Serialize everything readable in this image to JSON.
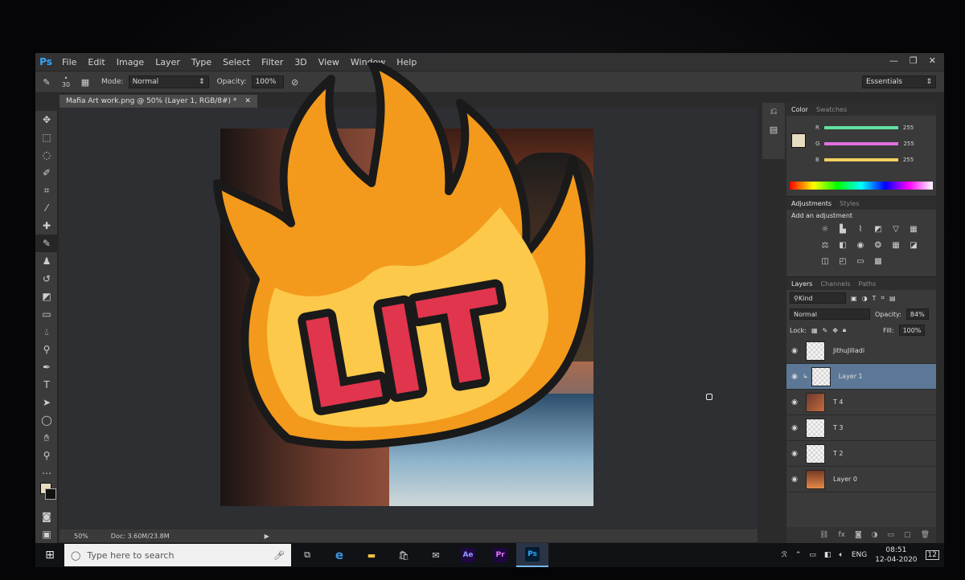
{
  "app": {
    "logo": "Ps",
    "menu": [
      "File",
      "Edit",
      "Image",
      "Layer",
      "Type",
      "Select",
      "Filter",
      "3D",
      "View",
      "Window",
      "Help"
    ],
    "window_controls": [
      "—",
      "❐",
      "✕"
    ]
  },
  "options_bar": {
    "brush_size": "30",
    "mode_label": "Mode:",
    "mode_value": "Normal",
    "opacity_label": "Opacity:",
    "opacity_value": "100%",
    "workspace": "Essentials"
  },
  "document": {
    "tab_title": "Mafia Art work.png @ 50% (Layer 1, RGB/8#) *",
    "close": "✕"
  },
  "status_bar": {
    "zoom": "50%",
    "doc_size": "Doc: 3.60M/23.8M"
  },
  "color_panel": {
    "tabs": [
      "Color",
      "Swatches"
    ],
    "channels": [
      {
        "label": "R",
        "value": "255",
        "color": "#5fe0a0"
      },
      {
        "label": "G",
        "value": "255",
        "color": "#e070e0"
      },
      {
        "label": "B",
        "value": "255",
        "color": "#f0d060"
      }
    ],
    "foreground": "#e6dcc2"
  },
  "adjustments_panel": {
    "tabs": [
      "Adjustments",
      "Styles"
    ],
    "title": "Add an adjustment",
    "icons": [
      "brightness-icon",
      "levels-icon",
      "curves-icon",
      "exposure-icon",
      "vibrance-icon",
      "hsl-icon",
      "color-balance-icon",
      "bw-icon",
      "photo-filter-icon",
      "channel-mixer-icon",
      "color-lookup-icon",
      "invert-icon",
      "posterize-icon",
      "threshold-icon",
      "gradient-map-icon",
      "selective-color-icon"
    ]
  },
  "layers_panel": {
    "tabs": [
      "Layers",
      "Channels",
      "Paths"
    ],
    "kind": "Kind",
    "blend_mode": "Normal",
    "opacity_label": "Opacity:",
    "opacity_value": "84%",
    "lock_label": "Lock:",
    "fill_label": "Fill:",
    "fill_value": "100%",
    "layers": [
      {
        "name": "JithuJilladi",
        "selected": false
      },
      {
        "name": "Layer 1",
        "selected": true
      },
      {
        "name": "T 4",
        "selected": false
      },
      {
        "name": "T 3",
        "selected": false
      },
      {
        "name": "T 2",
        "selected": false
      },
      {
        "name": "Layer 0",
        "selected": false
      }
    ]
  },
  "sticker": {
    "text": "LIT"
  },
  "taskbar": {
    "search_placeholder": "Type here to search",
    "apps": [
      "Ae",
      "Pr",
      "Ps"
    ],
    "language": "ENG",
    "time": "08:51",
    "date": "12-04-2020",
    "notifications": "12"
  },
  "colors": {
    "flame_outer": "#f39a1c",
    "flame_inner": "#fcc94a",
    "lit_text": "#e0354c",
    "outline": "#1a1a1a",
    "ps_blue": "#31a8ff"
  }
}
